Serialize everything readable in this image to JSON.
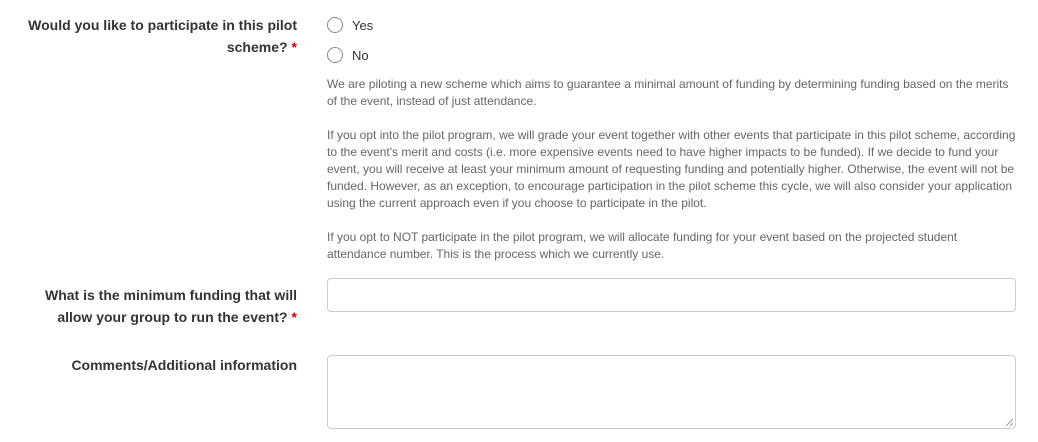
{
  "pilot_question": {
    "label_line1": "Would you like to participate in this pilot",
    "label_line2": "scheme?",
    "required_mark": "*",
    "options": [
      {
        "label": "Yes"
      },
      {
        "label": "No"
      }
    ],
    "help_paragraphs": [
      "We are piloting a new scheme which aims to guarantee a minimal amount of funding by determining funding based on the merits of the event, instead of just attendance.",
      "If you opt into the pilot program, we will grade your event together with other events that participate in this pilot scheme, according to the event's merit and costs (i.e. more expensive events need to have higher impacts to be funded). If we decide to fund your event, you will receive at least your minimum amount of requesting funding and potentially higher. Otherwise, the event will not be funded. However, as an exception, to encourage participation in the pilot scheme this cycle, we will also consider your application using the current approach even if you choose to participate in the pilot.",
      "If you opt to NOT participate in the pilot program, we will allocate funding for your event based on the projected student attendance number. This is the process which we currently use."
    ]
  },
  "min_funding": {
    "label_line1": "What is the minimum funding that will",
    "label_line2": "allow your group to run the event?",
    "required_mark": "*",
    "value": ""
  },
  "comments": {
    "label": "Comments/Additional information",
    "value": ""
  }
}
